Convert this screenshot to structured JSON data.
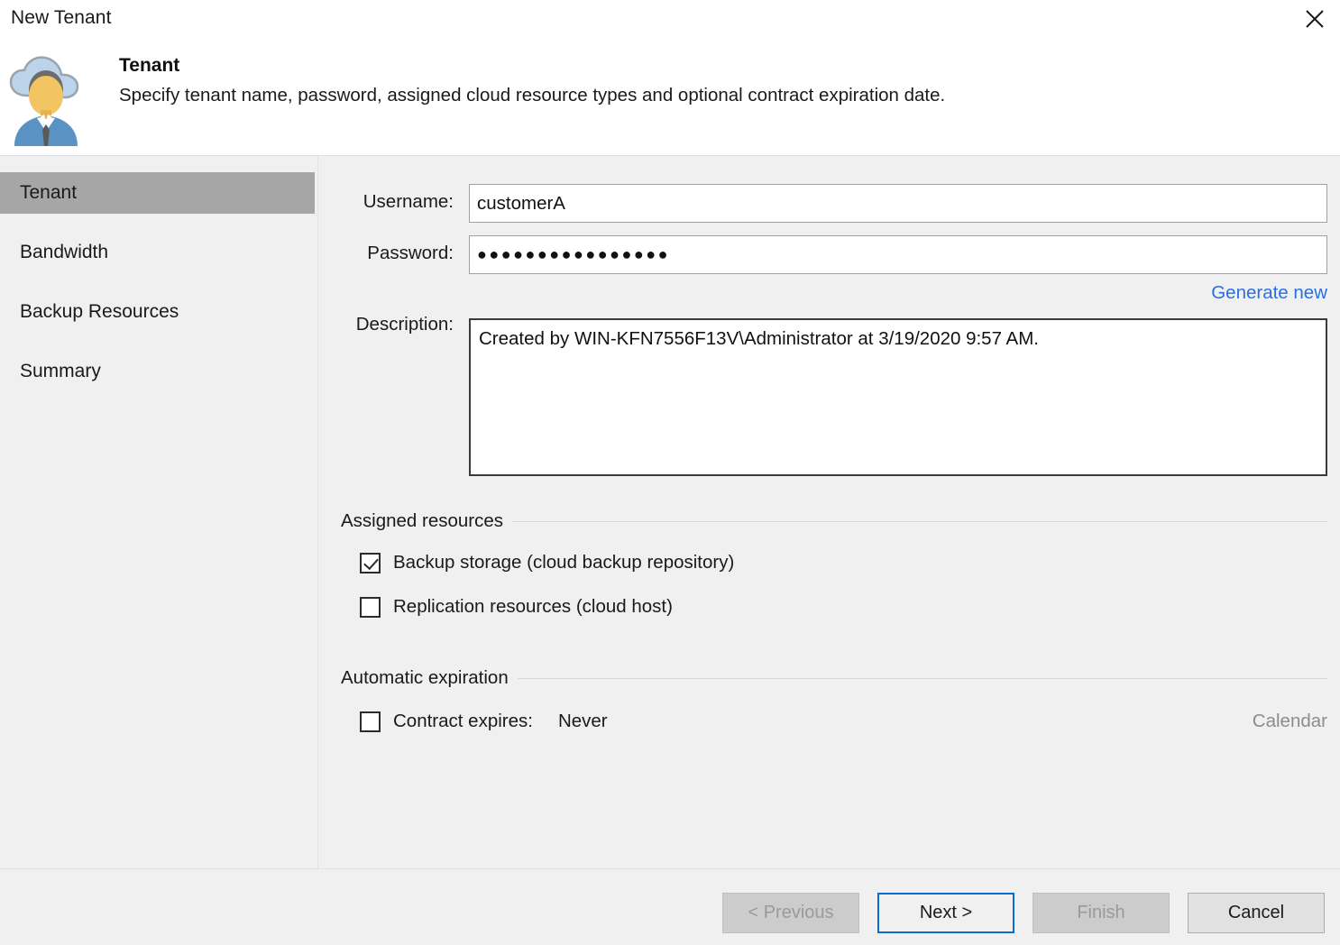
{
  "window": {
    "title": "New Tenant",
    "close_icon": "close-icon"
  },
  "header": {
    "icon": "cloud-user-icon",
    "title": "Tenant",
    "subtitle": "Specify tenant name, password, assigned cloud resource types and optional contract expiration date."
  },
  "sidebar": {
    "items": [
      {
        "label": "Tenant",
        "selected": true
      },
      {
        "label": "Bandwidth",
        "selected": false
      },
      {
        "label": "Backup Resources",
        "selected": false
      },
      {
        "label": "Summary",
        "selected": false
      }
    ]
  },
  "form": {
    "username": {
      "label": "Username:",
      "value": "customerA"
    },
    "password": {
      "label": "Password:",
      "value": "●●●●●●●●●●●●●●●●",
      "dot_count": 16
    },
    "generate_new_link": "Generate new",
    "description": {
      "label": "Description:",
      "value": "Created by WIN-KFN7556F13V\\Administrator at 3/19/2020 9:57 AM."
    },
    "assigned_resources": {
      "group_title": "Assigned resources",
      "options": [
        {
          "label": "Backup storage (cloud backup repository)",
          "checked": true
        },
        {
          "label": "Replication resources (cloud host)",
          "checked": false
        }
      ]
    },
    "automatic_expiration": {
      "group_title": "Automatic expiration",
      "contract_expires": {
        "label": "Contract expires:",
        "checked": false,
        "value": "Never"
      },
      "calendar_button": "Calendar"
    }
  },
  "footer": {
    "buttons": [
      {
        "label": "< Previous",
        "state": "disabled"
      },
      {
        "label": "Next >",
        "state": "default"
      },
      {
        "label": "Finish",
        "state": "disabled"
      },
      {
        "label": "Cancel",
        "state": "normal"
      }
    ]
  },
  "colors": {
    "accent_link": "#2a6fe0",
    "default_button_border": "#0a6cce",
    "sidebar_selected": "#a6a6a6",
    "panel_background": "#f0f0f0"
  }
}
